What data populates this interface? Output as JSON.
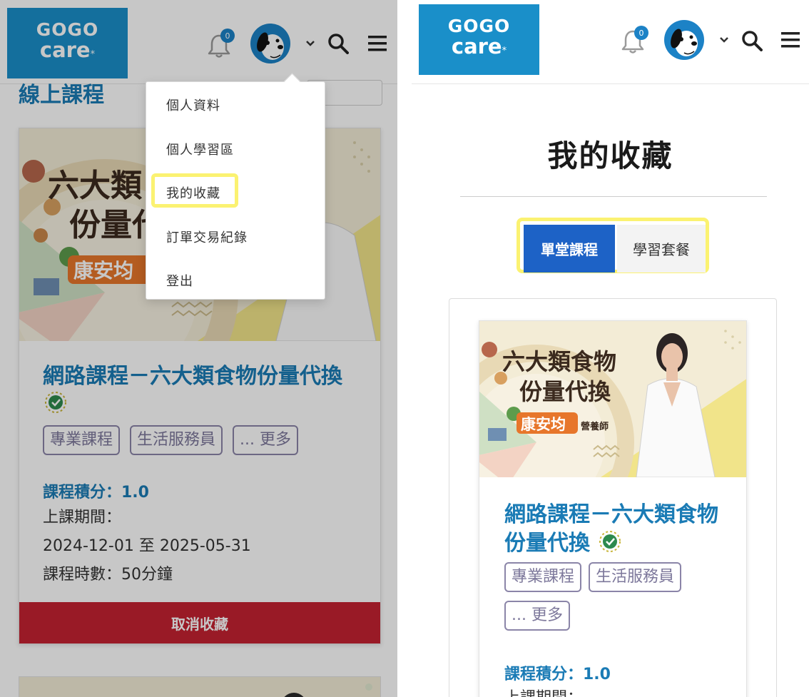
{
  "logo": {
    "line1": "GOGO",
    "line2": "care",
    "star": "*"
  },
  "header": {
    "notification_count": "0",
    "icons": [
      "bell-icon",
      "avatar-dog",
      "chevron-down-icon",
      "search-icon",
      "hamburger-menu-icon"
    ]
  },
  "left": {
    "page_heading_partial": "線上課程",
    "dropdown": {
      "items": [
        {
          "label": "個人資料"
        },
        {
          "label": "個人學習區"
        },
        {
          "label": "我的收藏",
          "highlighted": true
        },
        {
          "label": "訂單交易紀錄"
        },
        {
          "label": "登出"
        }
      ]
    },
    "course": {
      "banner_title_line1": "六大類食物",
      "banner_title_line2": "份量代換",
      "banner_instructor": "康安均",
      "title": "網路課程－六大類食物份量代換",
      "tags": [
        "專業課程",
        "生活服務員",
        "... 更多"
      ],
      "credit": "課程積分：1.0",
      "period_label": "上課期間：",
      "period_value": "2024-12-01 至 2025-05-31",
      "duration": "課程時數：50分鐘",
      "cancel_label": "取消收藏"
    }
  },
  "right": {
    "page_title": "我的收藏",
    "tabs": [
      {
        "label": "單堂課程",
        "active": true
      },
      {
        "label": "學習套餐",
        "active": false
      }
    ],
    "course": {
      "banner_title_line1": "六大類食物",
      "banner_title_line2": "份量代換",
      "banner_instructor": "康安均",
      "banner_instructor_role": "營養師",
      "title": "網路課程－六大類食物份量代換",
      "tags": [
        "專業課程",
        "生活服務員",
        "... 更多"
      ],
      "credit": "課程積分：1.0",
      "period_label_partial": "上課期間："
    }
  },
  "colors": {
    "brand_blue": "#1a8fc9",
    "title_blue": "#1a7bb5",
    "tab_active": "#1d62c6",
    "cancel_red": "#c42231",
    "highlight_yellow": "#fbf271"
  }
}
